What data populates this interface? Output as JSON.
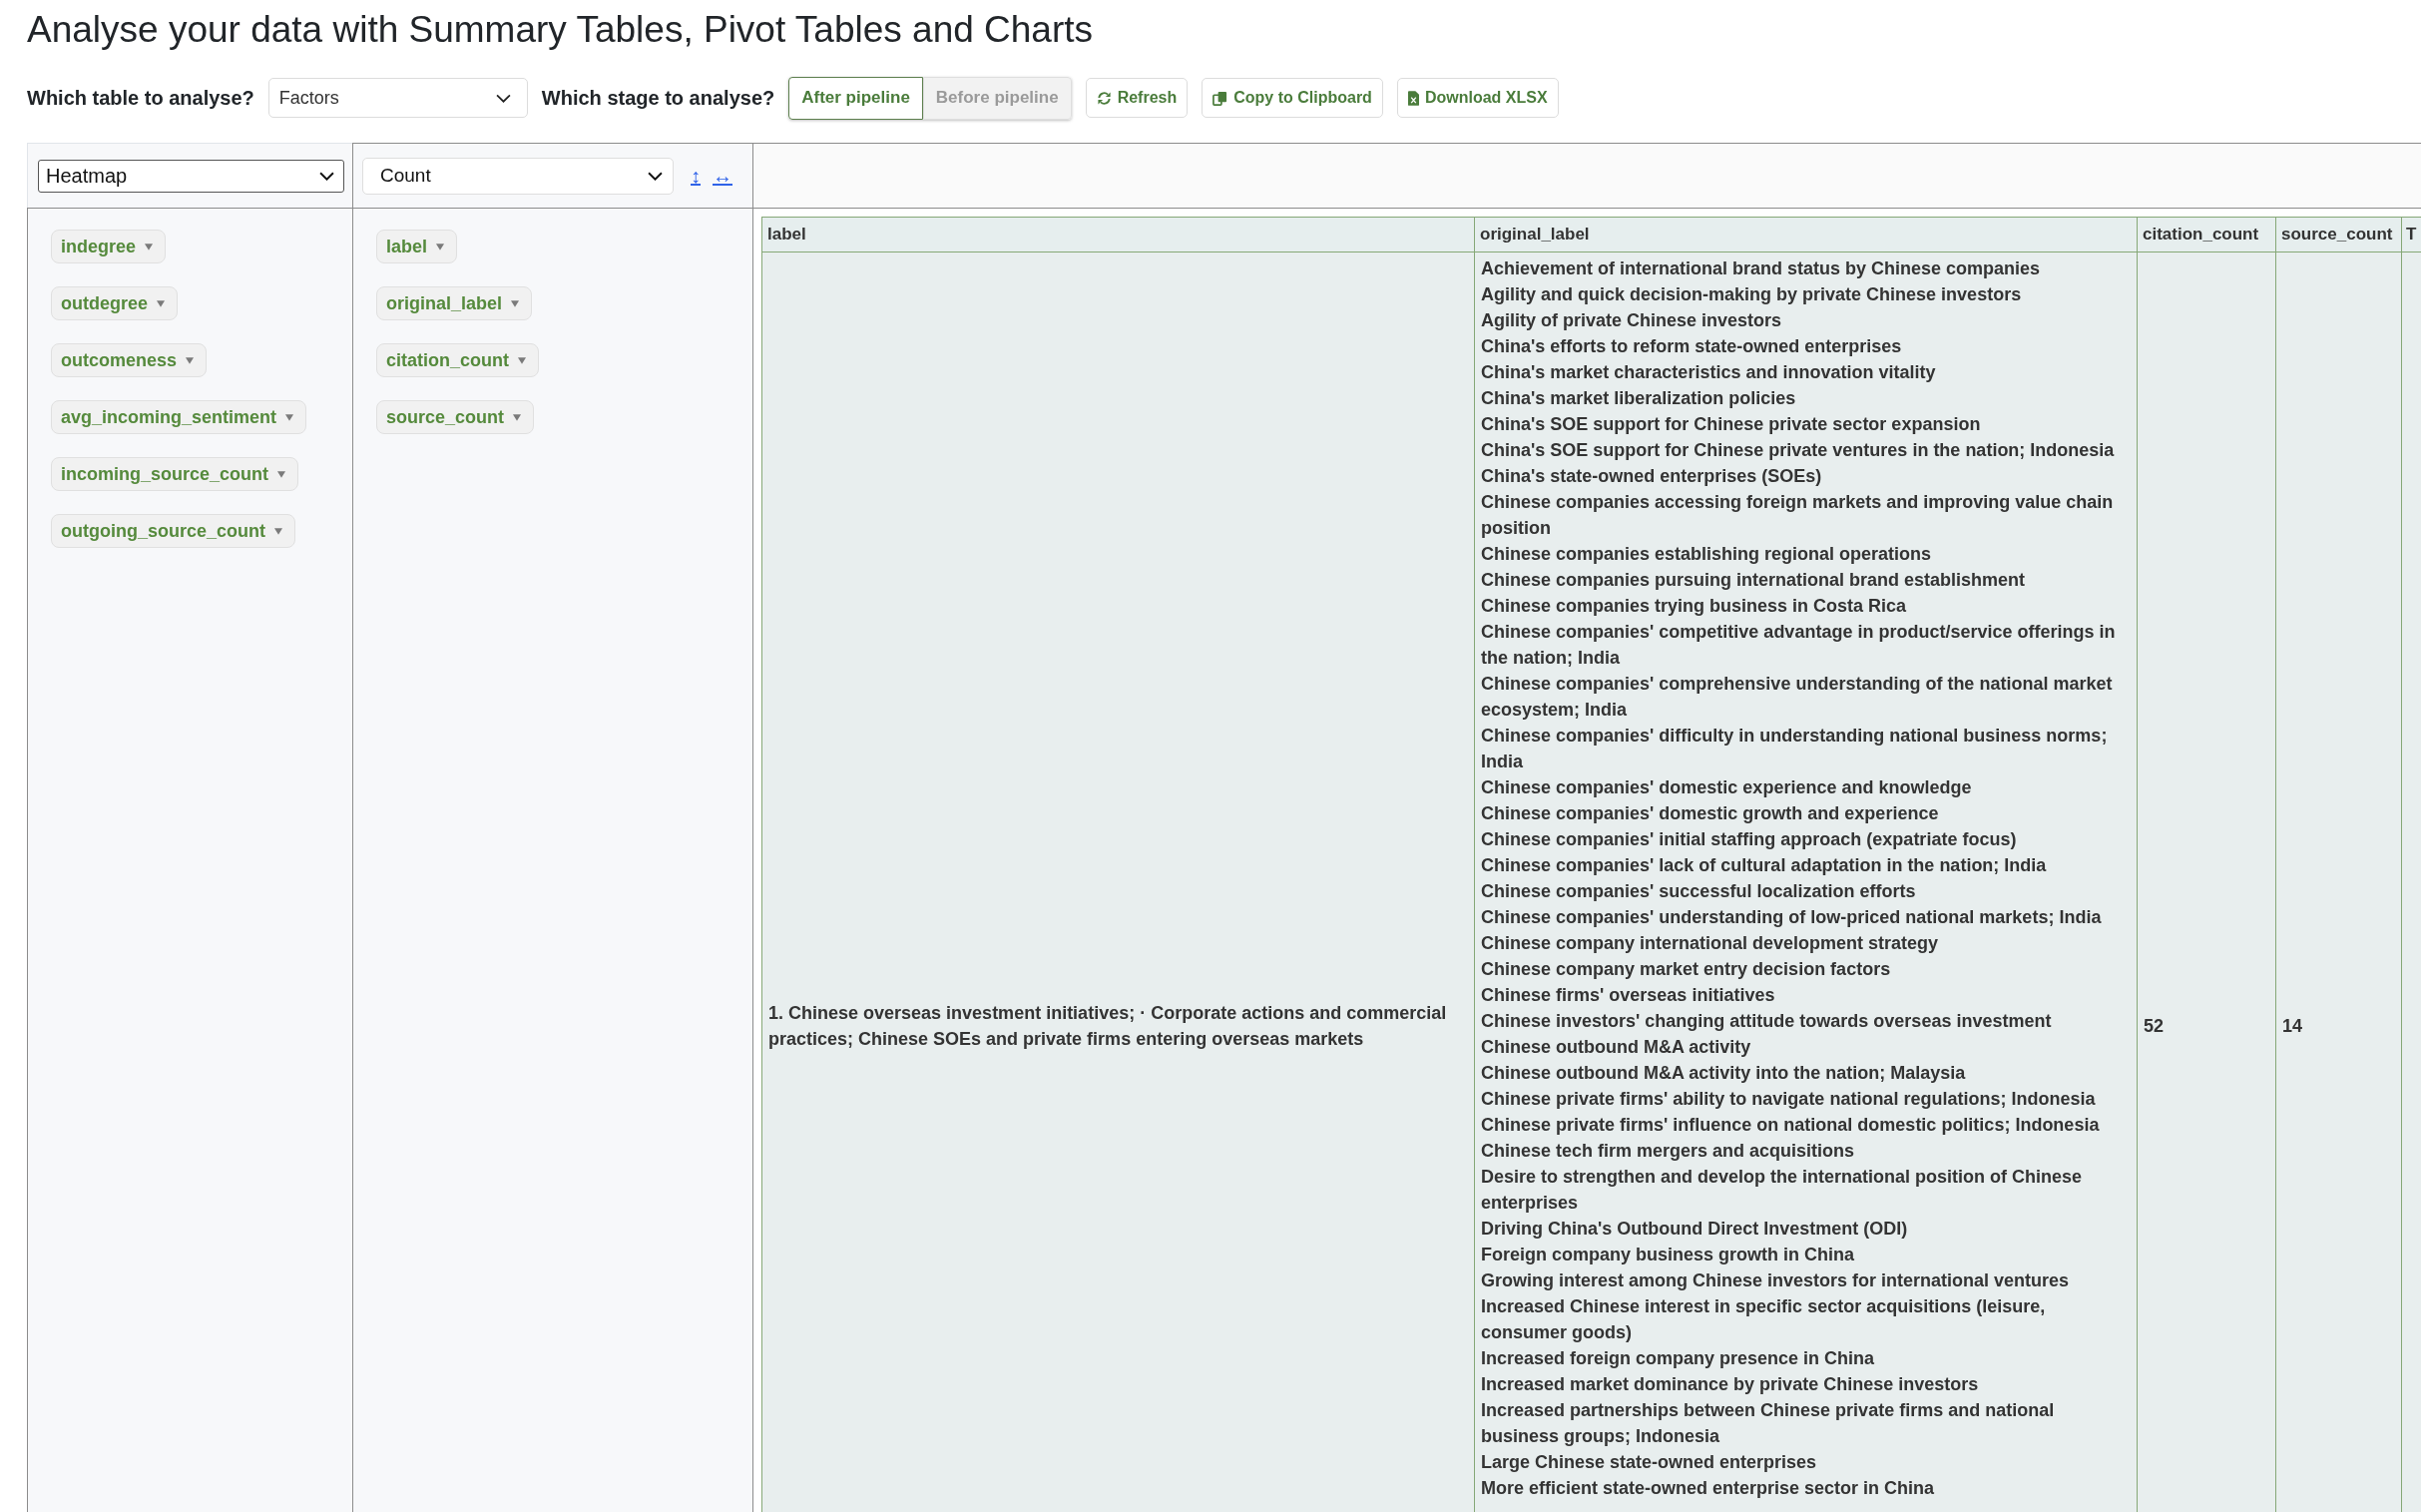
{
  "title": "Analyse your data with Summary Tables, Pivot Tables and Charts",
  "controls": {
    "table_label": "Which table to analyse?",
    "table_select": {
      "value": "Factors"
    },
    "stage_label": "Which stage to analyse?",
    "stage_options": [
      {
        "label": "After pipeline",
        "selected": true
      },
      {
        "label": "Before pipeline",
        "selected": false
      }
    ],
    "buttons": [
      {
        "label": "Refresh",
        "kind": "refresh"
      },
      {
        "label": "Copy to Clipboard",
        "kind": "copy"
      },
      {
        "label": "Download XLSX",
        "kind": "download"
      }
    ]
  },
  "pivot": {
    "renderer_select": {
      "value": "Heatmap"
    },
    "aggregator_select": {
      "value": "Count"
    },
    "sort_toggles": [
      "↕",
      "↔"
    ],
    "unused_attributes": [
      "indegree",
      "outdegree",
      "outcomeness",
      "avg_incoming_sentiment",
      "incoming_source_count",
      "outgoing_source_count"
    ],
    "row_attributes": [
      "label",
      "original_label",
      "citation_count",
      "source_count"
    ],
    "table": {
      "columns": [
        "label",
        "original_label",
        "citation_count",
        "source_count",
        "T"
      ],
      "rows": [
        {
          "label": "1. Chinese overseas investment initiatives; · Corporate actions and commercial practices; Chinese SOEs and private firms entering overseas markets",
          "original_label": [
            "Achievement of international brand status by Chinese companies",
            "Agility and quick decision-making by private Chinese investors",
            "Agility of private Chinese investors",
            "China's efforts to reform state-owned enterprises",
            "China's market characteristics and innovation vitality",
            "China's market liberalization policies",
            "China's SOE support for Chinese private sector expansion",
            "China's SOE support for Chinese private ventures in the nation; Indonesia",
            "China's state-owned enterprises (SOEs)",
            "Chinese companies accessing foreign markets and improving value chain position",
            "Chinese companies establishing regional operations",
            "Chinese companies pursuing international brand establishment",
            "Chinese companies trying business in Costa Rica",
            "Chinese companies' competitive advantage in product/service offerings in the nation; India",
            "Chinese companies' comprehensive understanding of the national market ecosystem; India",
            "Chinese companies' difficulty in understanding national business norms; India",
            "Chinese companies' domestic experience and knowledge",
            "Chinese companies' domestic growth and experience",
            "Chinese companies' initial staffing approach (expatriate focus)",
            "Chinese companies' lack of cultural adaptation in the nation; India",
            "Chinese companies' successful localization efforts",
            "Chinese companies' understanding of low-priced national markets; India",
            "Chinese company international development strategy",
            "Chinese company market entry decision factors",
            "Chinese firms' overseas initiatives",
            "Chinese investors' changing attitude towards overseas investment",
            "Chinese outbound M&A activity",
            "Chinese outbound M&A activity into the nation; Malaysia",
            "Chinese private firms' ability to navigate national regulations; Indonesia",
            "Chinese private firms' influence on national domestic politics; Indonesia",
            "Chinese tech firm mergers and acquisitions",
            "Desire to strengthen and develop the international position of Chinese enterprises",
            "Driving China's Outbound Direct Investment (ODI)",
            "Foreign company business growth in China",
            "Growing interest among Chinese investors for international ventures",
            "Increased Chinese interest in specific sector acquisitions (leisure, consumer goods)",
            "Increased foreign company presence in China",
            "Increased market dominance by private Chinese investors",
            "Increased partnerships between Chinese private firms and national business groups; Indonesia",
            "Large Chinese state-owned enterprises",
            "More efficient state-owned enterprise sector in China"
          ],
          "citation_count": "52",
          "source_count": "14"
        }
      ]
    }
  }
}
